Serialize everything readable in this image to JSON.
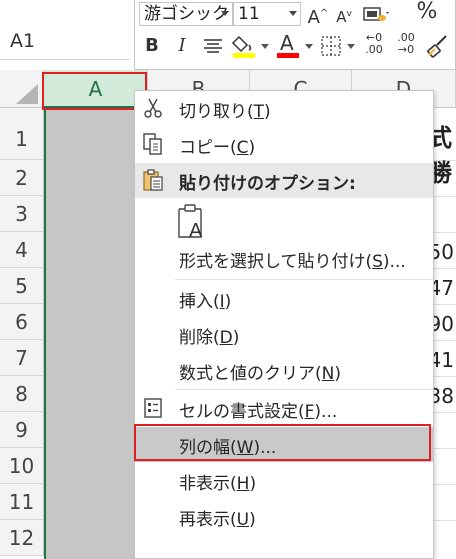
{
  "name_box": {
    "value": "A1"
  },
  "mini_toolbar": {
    "font_name": "游ゴシック",
    "font_size": "11",
    "increase_font_glyph": "A",
    "decrease_font_glyph": "A",
    "percent_glyph": "%",
    "bold_glyph": "B",
    "italic_glyph": "I",
    "font_color_glyph": "A",
    "inc_decimal_top": "←0",
    "inc_decimal_bottom": ".00",
    "dec_decimal_top": ".00",
    "dec_decimal_bottom": "→0",
    "highlight_color": "#ffff00",
    "font_color": "#ff0000"
  },
  "grid": {
    "columns": [
      "A",
      "B",
      "C",
      "D"
    ],
    "rows": [
      "1",
      "2",
      "3",
      "4",
      "5",
      "6",
      "7",
      "8",
      "9",
      "10",
      "11",
      "12"
    ],
    "title_fragment": "式勝",
    "values_col_d": [
      "50",
      "47",
      "90",
      "41",
      "38"
    ],
    "accent_color": "#217346"
  },
  "context_menu": {
    "cut": {
      "label": "切り取り(",
      "key": "T",
      "suffix": ")"
    },
    "copy": {
      "label": "コピー(",
      "key": "C",
      "suffix": ")"
    },
    "paste_options": {
      "label": "貼り付けのオプション:"
    },
    "paste_special": {
      "label": "形式を選択して貼り付け(",
      "key": "S",
      "suffix": ")..."
    },
    "insert": {
      "label": "挿入(",
      "key": "I",
      "suffix": ")"
    },
    "delete": {
      "label": "削除(",
      "key": "D",
      "suffix": ")"
    },
    "clear": {
      "label": "数式と値のクリア(",
      "key": "N",
      "suffix": ")"
    },
    "format_cells": {
      "label": "セルの書式設定(",
      "key": "F",
      "suffix": ")..."
    },
    "column_width": {
      "label": "列の幅(",
      "key": "W",
      "suffix": ")..."
    },
    "hide": {
      "label": "非表示(",
      "key": "H",
      "suffix": ")"
    },
    "unhide": {
      "label": "再表示(",
      "key": "U",
      "suffix": ")"
    }
  },
  "highlight_color": "#e02020"
}
